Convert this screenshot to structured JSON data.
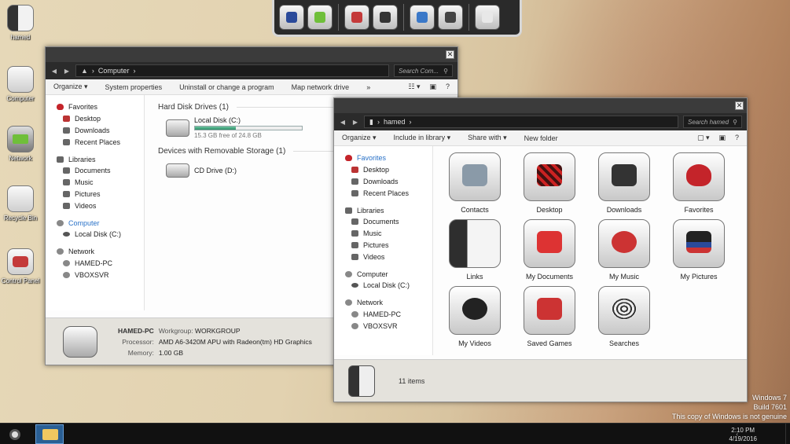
{
  "desktop_icons": [
    {
      "label": "hamed",
      "icon": "user-folder-icon"
    },
    {
      "label": "Computer",
      "icon": "computer-icon"
    },
    {
      "label": "Network",
      "icon": "network-icon"
    },
    {
      "label": "Recycle Bin",
      "icon": "recycle-bin-icon"
    },
    {
      "label": "Control Panel",
      "icon": "control-panel-icon"
    }
  ],
  "dock": {
    "icons": [
      "user-icon",
      "network-icon",
      "games-icon",
      "joystick-icon",
      "computer-icon",
      "drive-icon",
      "recycle-bin-icon"
    ]
  },
  "computer_window": {
    "breadcrumb": "Computer",
    "search_placeholder": "Search Com...",
    "toolbar": [
      "Organize ▾",
      "System properties",
      "Uninstall or change a program",
      "Map network drive"
    ],
    "nav": {
      "favorites": "Favorites",
      "favorites_items": [
        "Desktop",
        "Downloads",
        "Recent Places"
      ],
      "libraries": "Libraries",
      "libraries_items": [
        "Documents",
        "Music",
        "Pictures",
        "Videos"
      ],
      "computer": "Computer",
      "computer_items": [
        "Local Disk (C:)"
      ],
      "network": "Network",
      "network_items": [
        "HAMED-PC",
        "VBOXSVR"
      ]
    },
    "hard_disk_header": "Hard Disk Drives (1)",
    "local_disk": {
      "name": "Local Disk (C:)",
      "free": "15.3 GB free of 24.8 GB",
      "used_fraction": 0.38
    },
    "removable_header": "Devices with Removable Storage (1)",
    "cd_drive": "CD Drive (D:)",
    "details": {
      "pc_name": "HAMED-PC",
      "workgroup_label": "Workgroup:",
      "workgroup": "WORKGROUP",
      "processor_label": "Processor:",
      "processor": "AMD A6-3420M APU with Radeon(tm) HD Graphics",
      "memory_label": "Memory:",
      "memory": "1.00 GB"
    }
  },
  "hamed_window": {
    "breadcrumb": "hamed",
    "search_placeholder": "Search hamed",
    "toolbar": [
      "Organize ▾",
      "Include in library ▾",
      "Share with ▾",
      "New folder"
    ],
    "nav": {
      "favorites": "Favorites",
      "favorites_items": [
        "Desktop",
        "Downloads",
        "Recent Places"
      ],
      "libraries": "Libraries",
      "libraries_items": [
        "Documents",
        "Music",
        "Pictures",
        "Videos"
      ],
      "computer": "Computer",
      "computer_items": [
        "Local Disk (C:)"
      ],
      "network": "Network",
      "network_items": [
        "HAMED-PC",
        "VBOXSVR"
      ]
    },
    "items": [
      "Contacts",
      "Desktop",
      "Downloads",
      "Favorites",
      "Links",
      "My Documents",
      "My Music",
      "My Pictures",
      "My Videos",
      "Saved Games",
      "Searches"
    ],
    "status": "11 items"
  },
  "watermark": {
    "line1": "Windows 7",
    "line2": "Build 7601",
    "line3": "This copy of Windows is not genuine"
  },
  "taskbar": {
    "time": "2:10 PM",
    "date": "4/19/2016"
  },
  "colors": {
    "accent": "#2a72c8",
    "heart": "#c4242a",
    "bar_fill": "#2f8f6a",
    "chrome_dark": "#2b2b2b"
  }
}
